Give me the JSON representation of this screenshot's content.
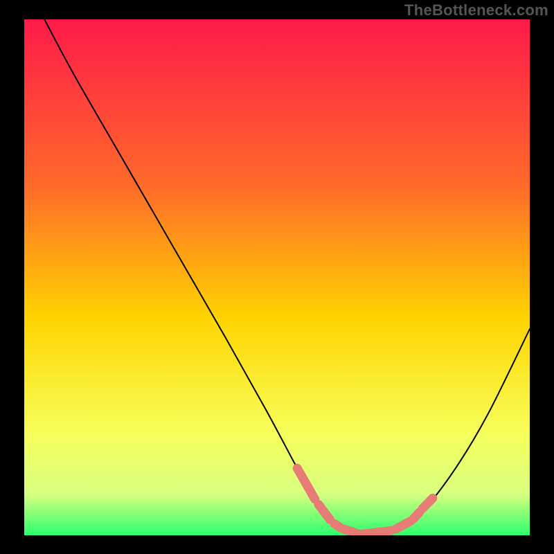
{
  "watermark": "TheBottleneck.com",
  "colors": {
    "background": "#000000",
    "gradient_top": "#ff1a4a",
    "gradient_upper_mid": "#ff6a2a",
    "gradient_mid": "#ffd400",
    "gradient_lower_mid": "#f7ff5a",
    "gradient_low": "#d8ff80",
    "gradient_bottom": "#2bff6e",
    "curve": "#000000",
    "marker_fill": "#e77b75",
    "marker_stroke": "#c94f49"
  },
  "chart_data": {
    "type": "line",
    "title": "",
    "xlabel": "",
    "ylabel": "",
    "xlim": [
      0,
      100
    ],
    "ylim": [
      0,
      100
    ],
    "series": [
      {
        "name": "bottleneck-curve",
        "x": [
          4,
          10,
          20,
          30,
          40,
          48,
          54,
          58,
          61,
          64,
          68,
          72,
          76,
          80,
          86,
          92,
          100
        ],
        "y": [
          100,
          89,
          72,
          55,
          38,
          24,
          13,
          6,
          2.5,
          1,
          0.2,
          0.8,
          2.5,
          6,
          14,
          24,
          40
        ]
      }
    ],
    "markers": {
      "name": "highlight-segments",
      "segments": [
        {
          "x": [
            54.0,
            57.5
          ],
          "y": [
            13.0,
            7.0
          ]
        },
        {
          "x": [
            58.2,
            60.5
          ],
          "y": [
            6.0,
            3.0
          ]
        },
        {
          "x": [
            61.4,
            62.5
          ],
          "y": [
            2.2,
            1.5
          ]
        },
        {
          "x": [
            63.2,
            66.0
          ],
          "y": [
            1.2,
            0.3
          ]
        },
        {
          "x": [
            66.5,
            72.5
          ],
          "y": [
            0.2,
            0.9
          ]
        },
        {
          "x": [
            73.5,
            76.5
          ],
          "y": [
            1.2,
            2.8
          ]
        },
        {
          "x": [
            77.0,
            78.2
          ],
          "y": [
            3.2,
            4.5
          ]
        },
        {
          "x": [
            78.8,
            80.8
          ],
          "y": [
            5.2,
            7.2
          ]
        }
      ]
    }
  }
}
